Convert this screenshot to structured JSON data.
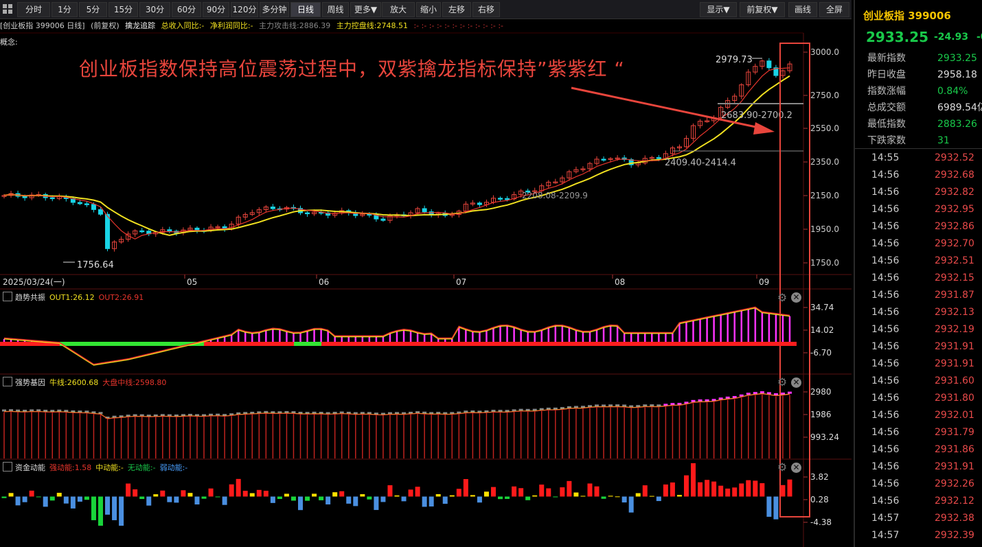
{
  "toolbar": {
    "buttons": [
      "分时",
      "1分",
      "5分",
      "15分",
      "30分",
      "60分",
      "90分",
      "120分",
      "多分钟",
      "日线",
      "周线",
      "更多▼",
      "放大",
      "缩小",
      "左移",
      "右移"
    ],
    "active": "日线",
    "right_buttons": [
      "显示▼",
      "前复权▼",
      "画线",
      "全屏"
    ]
  },
  "infobar": {
    "symbol": "[创业板指 399006 日线]",
    "adjust": "(前复权)",
    "indicator": "擒龙追踪",
    "revenue": "总收入同比:-",
    "profit": "净利润同比:-",
    "attack": "主力攻击线:2886.39",
    "control": "主力控盘线:2748.51",
    "tail": ":- :- :- :- :- :- :- :- :- :- :- :-"
  },
  "concept_label": "概念:",
  "annotation": "创业板指数保持高位震荡过程中，双紫擒龙指标保持”紫紫红 “",
  "main_chart": {
    "price_axis": [
      "3000.0",
      "2750.0",
      "2550.0",
      "2350.0",
      "2150.0",
      "1950.0",
      "1750.0"
    ],
    "labels": {
      "high": "2979.73",
      "low": "1756.64",
      "zone1": "2683.90-2700.2",
      "zone2": "2409.40-2414.4",
      "zone3": "2208.08-2209.9"
    },
    "date_axis": [
      "2025/03/24(一)",
      "05",
      "06",
      "07",
      "08",
      "09"
    ]
  },
  "panel1": {
    "name": "趋势共振",
    "out1": "OUT1:26.12",
    "out2": "OUT2:26.91",
    "axis": [
      "34.74",
      "14.02",
      "-6.70"
    ]
  },
  "panel2": {
    "name": "强势基因",
    "bull": "牛线:2600.68",
    "mid": "大盘中线:2598.80",
    "axis": [
      "2980",
      "1986",
      "993.24"
    ]
  },
  "panel3": {
    "name": "资金动能",
    "strong": "强动能:1.58",
    "medium": "中动能:-",
    "none": "无动能:-",
    "weak": "弱动能:-",
    "axis": [
      "3.82",
      "0.28",
      "-4.38"
    ]
  },
  "right_panel": {
    "title": "创业板指 399006",
    "price": "2933.25",
    "change": "-24.93",
    "change_pct": "-0.",
    "stats": [
      {
        "k": "最新指数",
        "v": "2933.25",
        "c": "#19c94a"
      },
      {
        "k": "昨日收盘",
        "v": "2958.18",
        "c": "#ddd"
      },
      {
        "k": "指数涨幅",
        "v": "0.84%",
        "c": "#19c94a"
      },
      {
        "k": "总成交额",
        "v": "6989.54亿",
        "c": "#ddd"
      },
      {
        "k": "最低指数",
        "v": "2883.26",
        "c": "#19c94a"
      },
      {
        "k": "下跌家数",
        "v": "31",
        "c": "#19c94a"
      }
    ],
    "ticks": [
      {
        "t": "14:55",
        "p": "2932.52"
      },
      {
        "t": "14:56",
        "p": "2932.68"
      },
      {
        "t": "14:56",
        "p": "2932.82"
      },
      {
        "t": "14:56",
        "p": "2932.95"
      },
      {
        "t": "14:56",
        "p": "2932.86"
      },
      {
        "t": "14:56",
        "p": "2932.70"
      },
      {
        "t": "14:56",
        "p": "2932.51"
      },
      {
        "t": "14:56",
        "p": "2932.15"
      },
      {
        "t": "14:56",
        "p": "2931.87"
      },
      {
        "t": "14:56",
        "p": "2932.13"
      },
      {
        "t": "14:56",
        "p": "2932.19"
      },
      {
        "t": "14:56",
        "p": "2931.91"
      },
      {
        "t": "14:56",
        "p": "2931.91"
      },
      {
        "t": "14:56",
        "p": "2931.60"
      },
      {
        "t": "14:56",
        "p": "2931.80"
      },
      {
        "t": "14:56",
        "p": "2932.01"
      },
      {
        "t": "14:56",
        "p": "2931.79"
      },
      {
        "t": "14:56",
        "p": "2931.86"
      },
      {
        "t": "14:56",
        "p": "2931.91"
      },
      {
        "t": "14:56",
        "p": "2932.26"
      },
      {
        "t": "14:56",
        "p": "2932.12"
      },
      {
        "t": "14:57",
        "p": "2932.38"
      },
      {
        "t": "14:57",
        "p": "2932.39"
      }
    ]
  },
  "colors": {
    "up": "#e8453c",
    "down": "#19d4e6",
    "ma_yellow": "#f0e020",
    "ma_red": "#e8352c",
    "magenta": "#ff33ff",
    "green": "#19c94a"
  }
}
